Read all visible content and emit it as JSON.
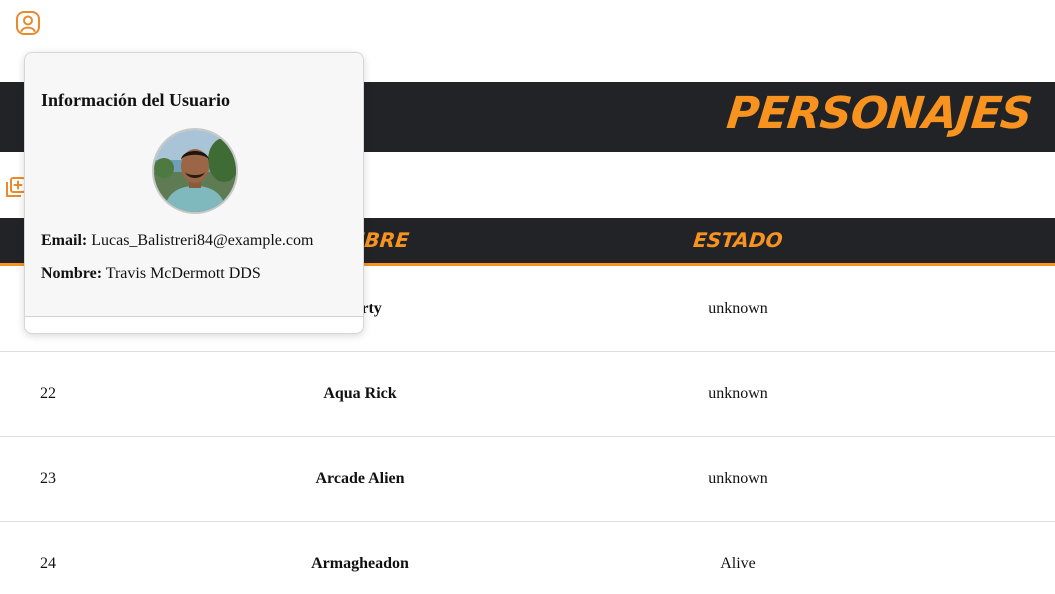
{
  "header": {
    "title": "PERSONAJES",
    "user_icon": "user-circle-icon",
    "add_icon": "add-stack-icon"
  },
  "table": {
    "columns": [
      "NOMBRE",
      "ESTADO"
    ],
    "rows": [
      {
        "id": "",
        "name": "Morty",
        "status": "unknown"
      },
      {
        "id": "22",
        "name": "Aqua Rick",
        "status": "unknown"
      },
      {
        "id": "23",
        "name": "Arcade Alien",
        "status": "unknown"
      },
      {
        "id": "24",
        "name": "Armagheadon",
        "status": "Alive"
      }
    ]
  },
  "user_popover": {
    "title": "Información del Usuario",
    "email_label": "Email:",
    "email": "Lucas_Balistreri84@example.com",
    "name_label": "Nombre:",
    "name": "Travis McDermott DDS"
  },
  "colors": {
    "accent": "#f7931e",
    "dark": "#212327"
  }
}
